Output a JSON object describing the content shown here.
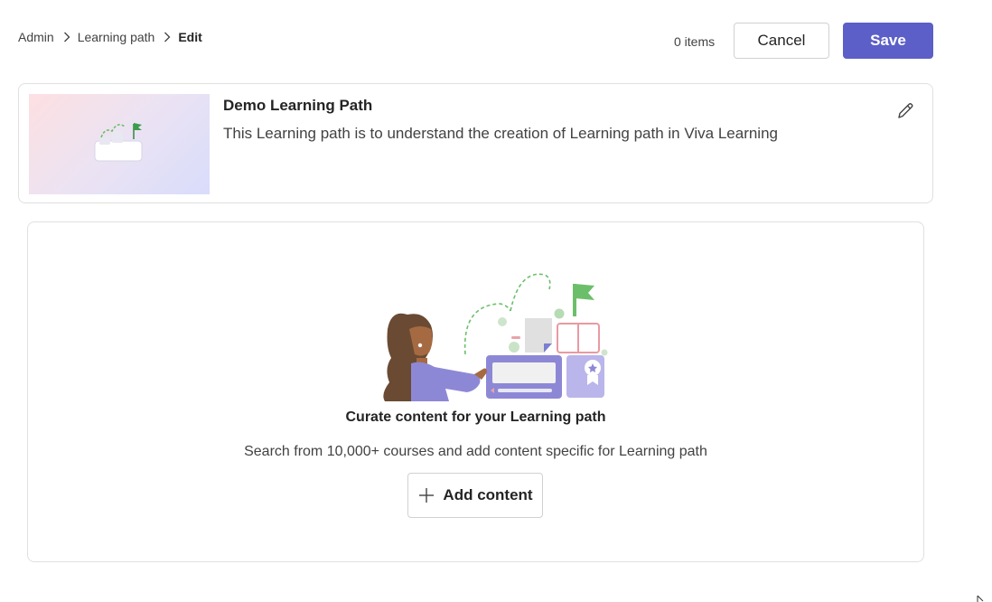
{
  "breadcrumb": {
    "items": [
      "Admin",
      "Learning path"
    ],
    "current": "Edit"
  },
  "header": {
    "items_count": "0 items",
    "cancel_label": "Cancel",
    "save_label": "Save"
  },
  "learning_path": {
    "title": "Demo Learning Path",
    "description": "This Learning path is to understand the creation of Learning path in Viva Learning"
  },
  "empty_state": {
    "title": "Curate content for your Learning path",
    "description": "Search from 10,000+ courses and add content specific for Learning path",
    "add_button_label": "Add content"
  },
  "icons": {
    "breadcrumb_separator": "chevron-right-icon",
    "edit": "pencil-icon",
    "add": "plus-icon"
  },
  "colors": {
    "brand": "#5b5fc7",
    "flag_green": "#6cbf6a",
    "illustration_purple": "#8d88d6"
  }
}
